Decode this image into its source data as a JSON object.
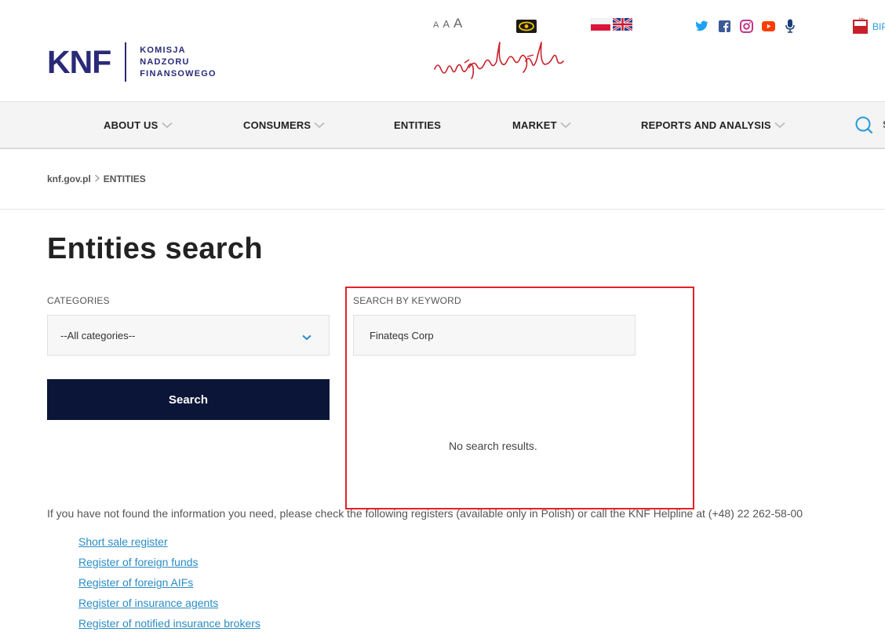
{
  "header": {
    "logo": {
      "mark": "KNF",
      "line1": "KOMISJA",
      "line2": "NADZORU",
      "line3": "FINANSOWEGO"
    },
    "font_sizes": [
      "A",
      "A",
      "A"
    ],
    "bip_label": "BIP",
    "icons": [
      "eye-icon",
      "flag-pl-icon",
      "flag-uk-icon",
      "twitter-icon",
      "facebook-icon",
      "instagram-icon",
      "youtube-icon",
      "microphone-icon",
      "bip-icon"
    ]
  },
  "nav": {
    "items": [
      {
        "label": "ABOUT US",
        "has_dropdown": true
      },
      {
        "label": "CONSUMERS",
        "has_dropdown": true
      },
      {
        "label": "ENTITIES",
        "has_dropdown": false
      },
      {
        "label": "MARKET",
        "has_dropdown": true
      },
      {
        "label": "REPORTS AND ANALYSIS",
        "has_dropdown": true
      }
    ],
    "search_partial": "S"
  },
  "breadcrumb": {
    "home": "knf.gov.pl",
    "current": "ENTITIES"
  },
  "main": {
    "title": "Entities search",
    "categories_label": "CATEGORIES",
    "categories_value": "--All categories--",
    "keyword_label": "SEARCH BY KEYWORD",
    "keyword_value": "Finateqs Corp",
    "search_button": "Search",
    "no_results": "No search results.",
    "info_text": "If you have not found the information you need, please check the following registers (available only in Polish) or call the KNF Helpline at (+48) 22 262-58-00",
    "links": [
      "Short sale register",
      "Register of foreign funds",
      "Register of foreign AIFs",
      "Register of insurance agents",
      "Register of notified insurance brokers"
    ]
  },
  "colors": {
    "brand": "#2a2a78",
    "button": "#0b1538",
    "link": "#2a8cc4",
    "highlight": "#e8202a",
    "accent_search": "#2a9ad6"
  }
}
